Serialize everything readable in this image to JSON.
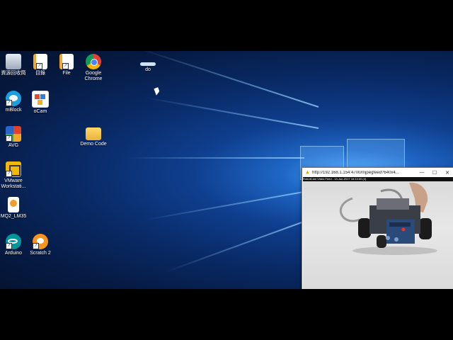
{
  "desktop": {
    "icons": [
      {
        "label": "資源回收筒",
        "icon": "recycle-bin-icon"
      },
      {
        "label": "目錄",
        "icon": "document-icon"
      },
      {
        "label": "File",
        "icon": "document-icon"
      },
      {
        "label": "Google Chrome",
        "icon": "chrome-icon"
      },
      {
        "label": "do",
        "icon": "shortcut-icon"
      },
      {
        "label": "mBlock",
        "icon": "mblock-icon"
      },
      {
        "label": "oCam",
        "icon": "ocam-icon"
      },
      {
        "label": "AVG",
        "icon": "avg-icon"
      },
      {
        "label": "Demo Code",
        "icon": "folder-icon"
      },
      {
        "label": "VMware Workstati...",
        "icon": "vmware-icon"
      },
      {
        "label": "MQ2_LM35",
        "icon": "scratch-file-icon"
      },
      {
        "label": "Arduino",
        "icon": "arduino-icon"
      },
      {
        "label": "Scratch 2",
        "icon": "scratch-icon"
      }
    ]
  },
  "stream_window": {
    "url": "http://192.168.1.154:4700/mjpegfeed?640x4...",
    "minimize": "—",
    "maximize": "☐",
    "close": "✕",
    "overlay_text": "RobotCam Video Feed - 13-Jun-2017 16:13:00 (4)"
  }
}
